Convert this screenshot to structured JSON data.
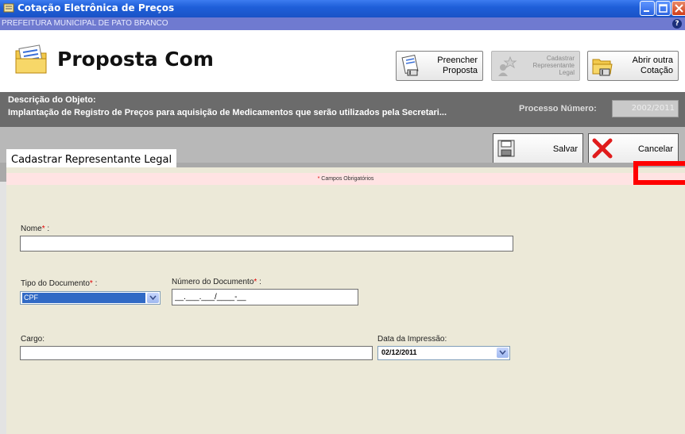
{
  "window": {
    "title": "Cotação Eletrônica de Preços",
    "subtitle": "PREFEITURA MUNICIPAL DE PATO BRANCO",
    "help": "?"
  },
  "header": {
    "title": "Proposta Com"
  },
  "toolbar": {
    "preencher": {
      "line1": "Preencher",
      "line2": "Proposta"
    },
    "cadastrar": {
      "line1": "Cadastrar",
      "line2": "Representante",
      "line3": "Legal"
    },
    "abrir": {
      "line1": "Abrir outra",
      "line2": "Cotação"
    }
  },
  "description": {
    "label": "Descrição do Objeto:",
    "value": "Implantação de Registro de Preços para aquisição de Medicamentos que serão utilizados pela Secretari...",
    "process_label": "Processo Número:",
    "process_value": "2002/2011"
  },
  "actions": {
    "save": "Salvar",
    "cancel": "Cancelar"
  },
  "tab": {
    "label": "Cadastrar Representante Legal"
  },
  "form": {
    "required_note": "Campos Obrigatórios",
    "required_star": "*",
    "nome": {
      "label": "Nome",
      "suffix": " :",
      "value": ""
    },
    "tipo_documento": {
      "label": "Tipo do Documento",
      "suffix": " :",
      "value": "CPF"
    },
    "numero_documento": {
      "label": "Número do Documento",
      "suffix": " :",
      "value": "__.___.___/____-__"
    },
    "cargo": {
      "label": "Cargo:",
      "value": ""
    },
    "data_impressao": {
      "label": "Data da Impressão:",
      "value": "02/12/2011"
    }
  },
  "colors": {
    "titlebar": "#1f5fd9",
    "subbar": "#6f7ad0",
    "description_bar": "#6b6b6b",
    "required_bg": "#ffe3e3",
    "required_star": "#e00000",
    "highlight": "#ff0000"
  }
}
